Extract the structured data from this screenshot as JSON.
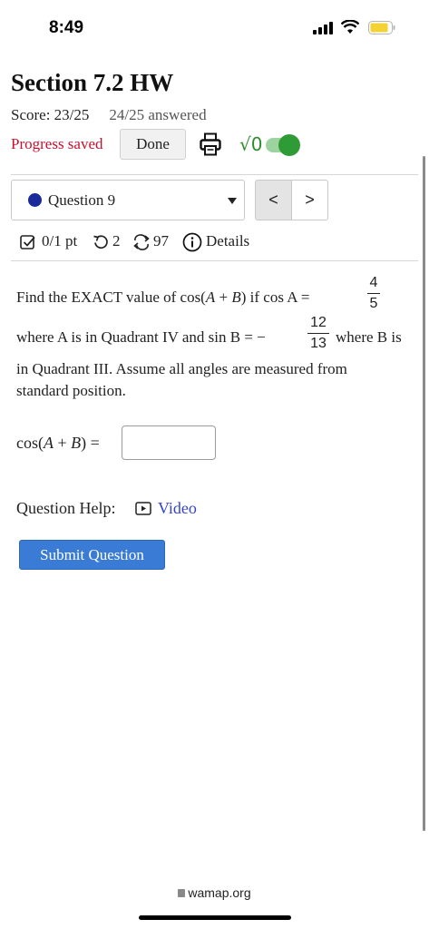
{
  "status_bar": {
    "time": "8:49"
  },
  "header": {
    "title": "Section 7.2 HW",
    "score": "Score: 23/25",
    "answered": "24/25 answered",
    "progress_status": "Progress saved",
    "done_label": "Done",
    "toggle_label": "√0",
    "toggle_on": true
  },
  "question_nav": {
    "current": "Question 9",
    "prev_label": "<",
    "next_label": ">"
  },
  "meta": {
    "points": "0/1 pt",
    "retries": "2",
    "attempts": "97",
    "details_label": "Details"
  },
  "question": {
    "line1_text": "Find the EXACT value of cos(",
    "line1_A": "A",
    "line1_plus": " + ",
    "line1_B": "B",
    "line1_rest": ") if cos A =",
    "frac1_num": "4",
    "frac1_den": "5",
    "line2_text": "where A is in Quadrant IV and sin B = −",
    "frac2_num": "12",
    "frac2_den": "13",
    "line2_end": "where B is",
    "line3_text": "in Quadrant III. Assume all angles are measured from",
    "line4_text": "standard position."
  },
  "answer": {
    "label_prefix": "cos(",
    "label_A": "A",
    "label_plus": " + ",
    "label_B": "B",
    "label_suffix": ") =",
    "value": ""
  },
  "help": {
    "label": "Question Help:",
    "video_label": "Video"
  },
  "submit_label": "Submit Question",
  "browser": {
    "url": "wamap.org"
  },
  "colors": {
    "accent_blue": "#3a7bd5",
    "saved_red": "#c8102e",
    "toggle_green": "#2e9b37",
    "link_blue": "#3344cc"
  }
}
